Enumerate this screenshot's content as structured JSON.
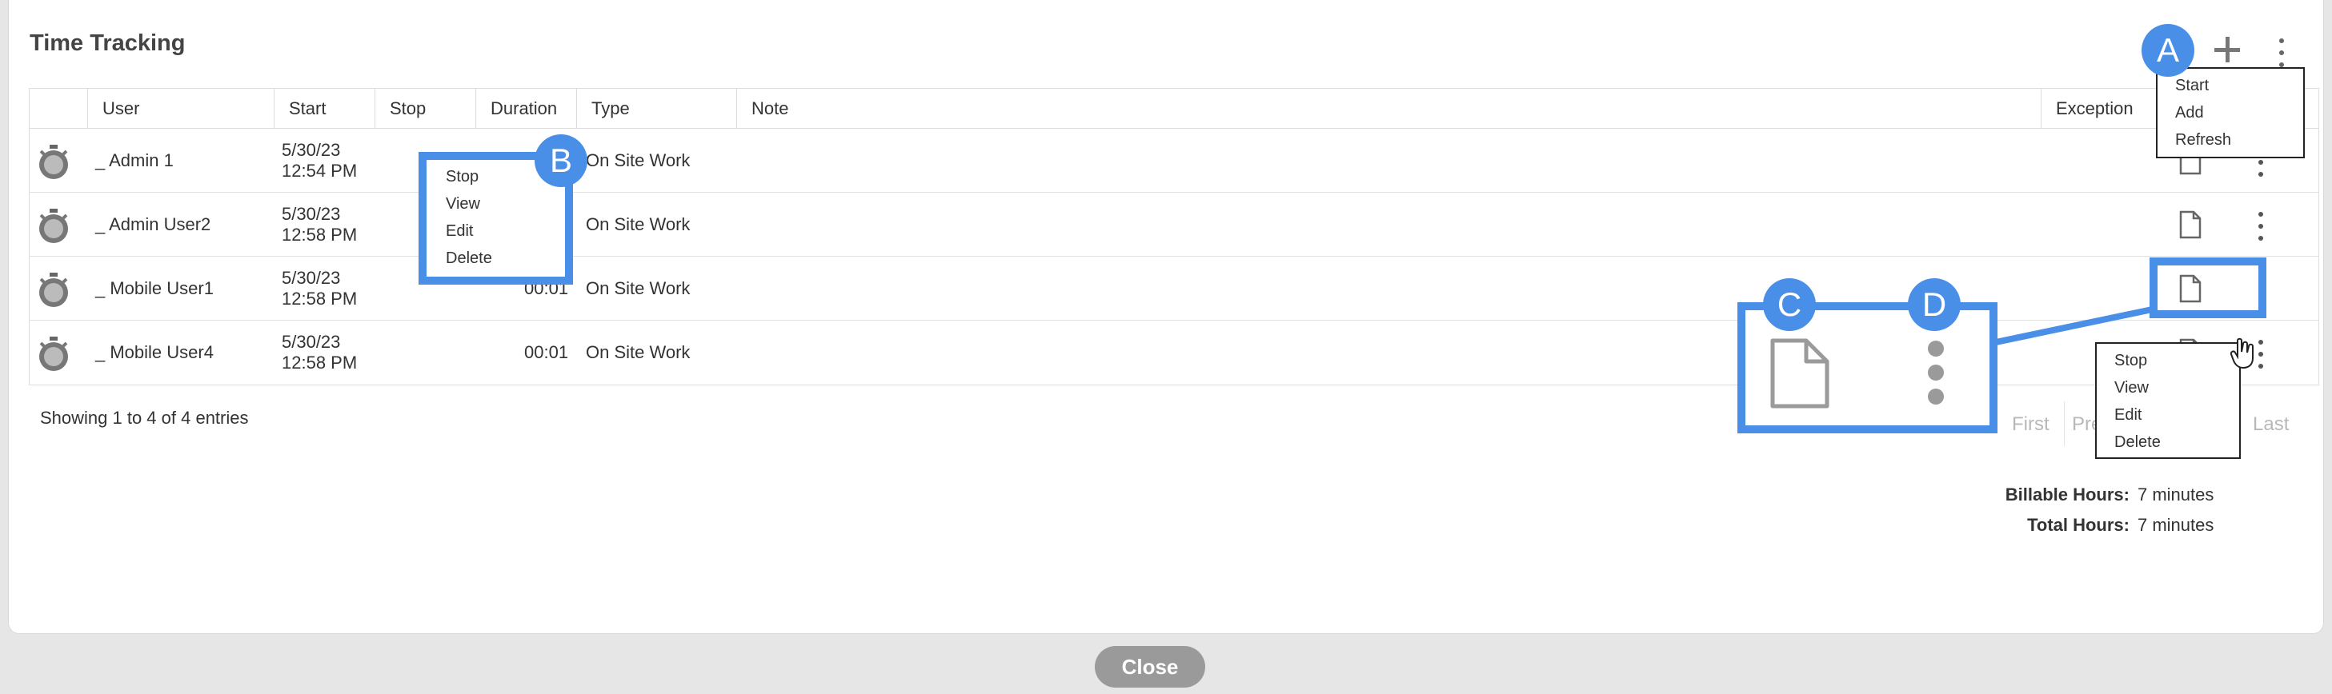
{
  "window": {
    "title": "Time Tracking"
  },
  "table": {
    "columns": [
      "",
      "User",
      "Start",
      "Stop",
      "Duration",
      "Type",
      "Note",
      "Exception"
    ],
    "rows": [
      {
        "user": "_ Admin 1",
        "start_date": "5/30/23",
        "start_time": "12:54 PM",
        "stop": "",
        "duration": "",
        "type": "On Site Work",
        "note": ""
      },
      {
        "user": "_ Admin User2",
        "start_date": "5/30/23",
        "start_time": "12:58 PM",
        "stop": "",
        "duration": "",
        "type": "On Site Work",
        "note": ""
      },
      {
        "user": "_ Mobile User1",
        "start_date": "5/30/23",
        "start_time": "12:58 PM",
        "stop": "",
        "duration": "00:01",
        "type": "On Site Work",
        "note": ""
      },
      {
        "user": "_ Mobile User4",
        "start_date": "5/30/23",
        "start_time": "12:58 PM",
        "stop": "",
        "duration": "00:01",
        "type": "On Site Work",
        "note": ""
      }
    ]
  },
  "footer": {
    "entries_text": "Showing 1 to 4 of 4 entries",
    "pager": {
      "first": "First",
      "prev": "Pre",
      "last": "Last"
    }
  },
  "summary": {
    "billable_label": "Billable Hours:",
    "billable_value": "7 minutes",
    "total_label": "Total Hours:",
    "total_value": "7 minutes"
  },
  "toolbar_menu": [
    "Start",
    "Add",
    "Refresh"
  ],
  "row_menu_b": [
    "Stop",
    "View",
    "Edit",
    "Delete"
  ],
  "row_menu_d": [
    "Stop",
    "View",
    "Edit",
    "Delete"
  ],
  "callouts": {
    "a": "A",
    "b": "B",
    "c": "C",
    "d": "D"
  },
  "close_label": "Close",
  "icons": {
    "row": "stopwatch-icon",
    "plus": "plus-icon",
    "more": "kebab-icon",
    "doc": "document-icon"
  },
  "colors": {
    "highlight": "#4a8fe7",
    "close_button": "#9a9a9a"
  }
}
